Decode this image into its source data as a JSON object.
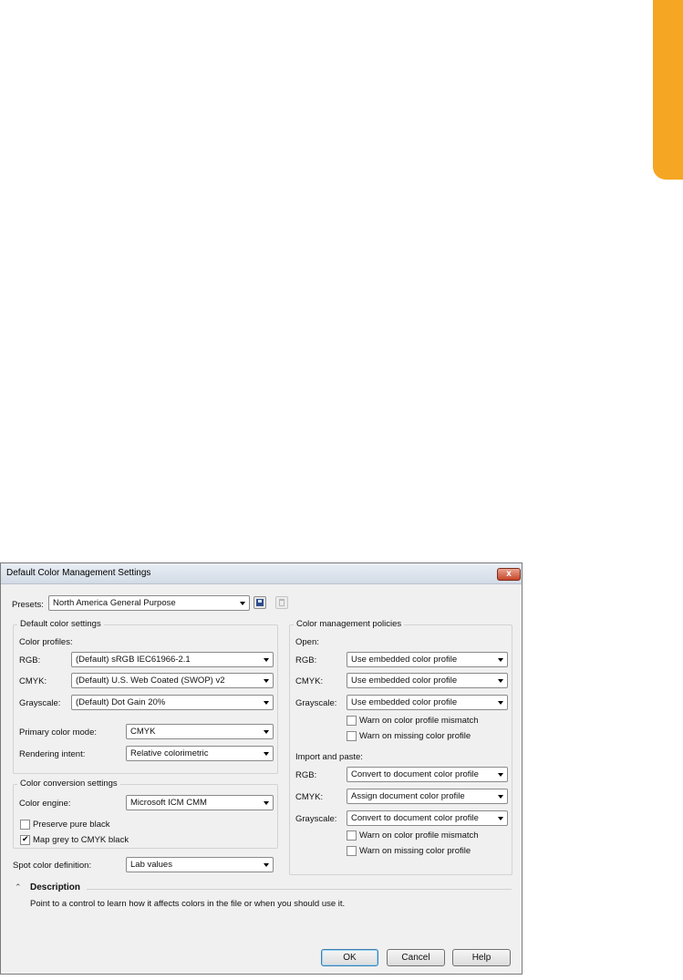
{
  "dialog": {
    "title": "Default Color Management Settings",
    "close_glyph": "x",
    "presets": {
      "label": "Presets:",
      "value": "North America General Purpose"
    },
    "default_color_settings": {
      "title": "Default color settings",
      "color_profiles_label": "Color profiles:",
      "rgb": {
        "label": "RGB:",
        "value": "(Default) sRGB IEC61966-2.1"
      },
      "cmyk": {
        "label": "CMYK:",
        "value": "(Default) U.S. Web Coated (SWOP) v2"
      },
      "grayscale": {
        "label": "Grayscale:",
        "value": "(Default) Dot Gain 20%"
      },
      "primary_color_mode": {
        "label": "Primary color mode:",
        "value": "CMYK"
      },
      "rendering_intent": {
        "label": "Rendering intent:",
        "value": "Relative colorimetric"
      }
    },
    "color_conversion_settings": {
      "title": "Color conversion settings",
      "color_engine": {
        "label": "Color engine:",
        "value": "Microsoft ICM CMM"
      },
      "preserve_pure_black": {
        "label": "Preserve pure black",
        "checked": false
      },
      "map_grey": {
        "label": "Map grey to CMYK black",
        "checked": true
      }
    },
    "spot_color": {
      "label": "Spot color definition:",
      "value": "Lab values"
    },
    "color_management_policies": {
      "title": "Color management policies",
      "open": {
        "label": "Open:",
        "rgb": {
          "label": "RGB:",
          "value": "Use embedded color profile"
        },
        "cmyk": {
          "label": "CMYK:",
          "value": "Use embedded color profile"
        },
        "grayscale": {
          "label": "Grayscale:",
          "value": "Use embedded color profile"
        },
        "warn_mismatch": {
          "label": "Warn on color profile mismatch",
          "checked": false
        },
        "warn_missing": {
          "label": "Warn on missing color profile",
          "checked": false
        }
      },
      "import": {
        "label": "Import and paste:",
        "rgb": {
          "label": "RGB:",
          "value": "Convert to document color profile"
        },
        "cmyk": {
          "label": "CMYK:",
          "value": "Assign document color profile"
        },
        "grayscale": {
          "label": "Grayscale:",
          "value": "Convert to document color profile"
        },
        "warn_mismatch": {
          "label": "Warn on color profile mismatch",
          "checked": false
        },
        "warn_missing": {
          "label": "Warn on missing color profile",
          "checked": false
        }
      }
    },
    "description": {
      "title": "Description",
      "text": "Point to a control to learn how it affects colors in the file or when you should use it."
    },
    "buttons": {
      "ok": "OK",
      "cancel": "Cancel",
      "help": "Help"
    }
  },
  "colors": {
    "accent_tab": "#f5a623",
    "close_button": "#c6452a",
    "dialog_bg": "#f0f0f0"
  }
}
